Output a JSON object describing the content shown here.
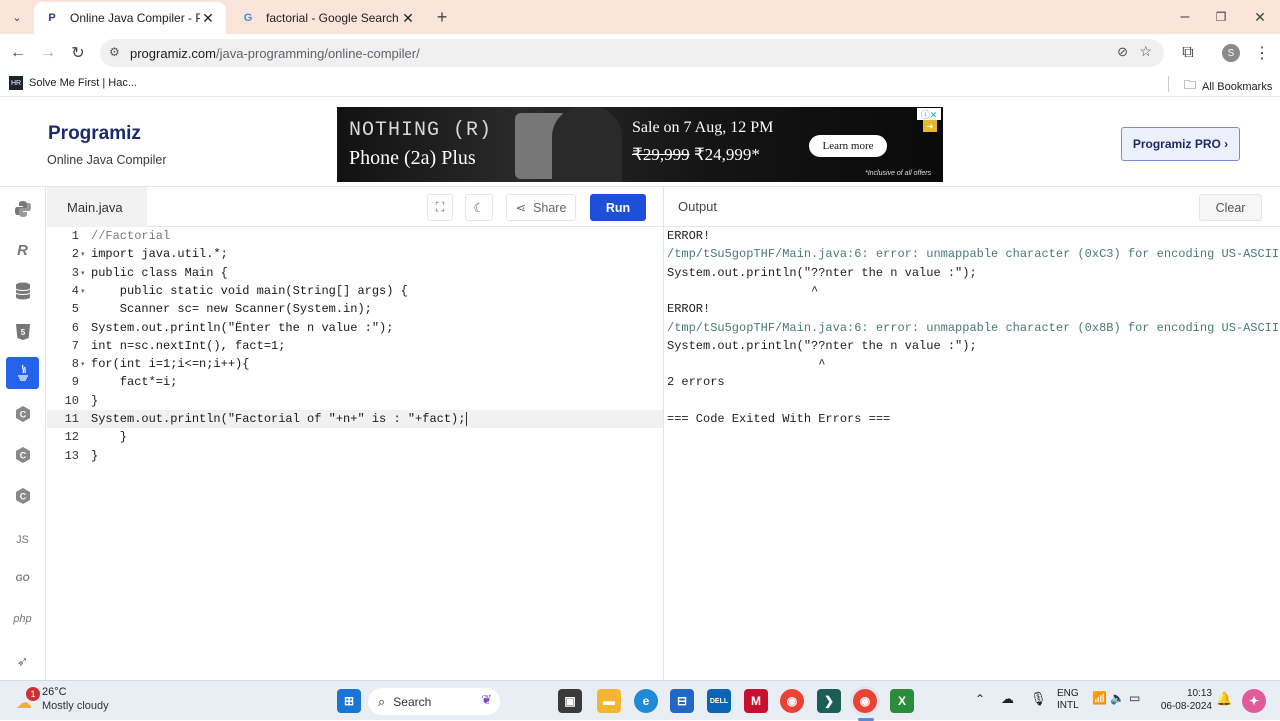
{
  "browser": {
    "tabs": [
      {
        "label": "Online Java Compiler - Program",
        "icon": "programiz-icon",
        "active": true
      },
      {
        "label": "factorial - Google Search",
        "icon": "google-icon",
        "active": false
      }
    ],
    "url_domain": "programiz.com",
    "url_path": "/java-programming/online-compiler/",
    "profile_initial": "S",
    "bookmarks": [
      {
        "label": "Solve Me First | Hac...",
        "icon": "hackerrank-icon"
      }
    ],
    "all_bookmarks": "All Bookmarks"
  },
  "site": {
    "logo_text": "Programiz",
    "logo_sub": "Online Java Compiler",
    "pro_button": "Programiz PRO ›",
    "ad": {
      "brand": "NOTHING (R)",
      "product": "Phone (2a) Plus",
      "sale": "Sale on 7 Aug, 12 PM",
      "old_price": "₹29,999",
      "new_price": "₹24,999*",
      "cta": "Learn more",
      "note": "*Inclusive of all offers"
    },
    "sidebar": [
      {
        "name": "python",
        "label": ""
      },
      {
        "name": "r",
        "label": ""
      },
      {
        "name": "sql",
        "label": ""
      },
      {
        "name": "html",
        "label": ""
      },
      {
        "name": "java",
        "label": ""
      },
      {
        "name": "c",
        "label": ""
      },
      {
        "name": "cpp",
        "label": ""
      },
      {
        "name": "csharp",
        "label": ""
      },
      {
        "name": "js",
        "label": "JS"
      },
      {
        "name": "go",
        "label": "GO"
      },
      {
        "name": "php",
        "label": "php"
      },
      {
        "name": "swift",
        "label": ""
      }
    ],
    "editor": {
      "file_name": "Main.java",
      "share_label": "Share",
      "run_label": "Run",
      "lines": [
        "//Factorial",
        "import java.util.*;",
        "public class Main {",
        "    public static void main(String[] args) {",
        "    Scanner sc= new Scanner(System.in);",
        "System.out.println(\"Ënter the n value :\");",
        "int n=sc.nextInt(), fact=1;",
        "for(int i=1;i<=n;i++){",
        "    fact*=i;",
        "}",
        "System.out.println(\"Factorial of \"+n+\" is : \"+fact);",
        "    }",
        "}"
      ]
    },
    "output": {
      "title": "Output",
      "clear_label": "Clear",
      "lines": [
        {
          "text": "ERROR!",
          "type": "plain"
        },
        {
          "text": "/tmp/tSu5gopTHF/Main.java:6: error: unmappable character (0xC3) for encoding US-ASCII",
          "type": "err"
        },
        {
          "text": "System.out.println(\"??nter the n value :\");",
          "type": "plain"
        },
        {
          "text": "                    ^",
          "type": "plain"
        },
        {
          "text": "ERROR!",
          "type": "plain"
        },
        {
          "text": "/tmp/tSu5gopTHF/Main.java:6: error: unmappable character (0x8B) for encoding US-ASCII",
          "type": "err"
        },
        {
          "text": "System.out.println(\"??nter the n value :\");",
          "type": "plain"
        },
        {
          "text": "                     ^",
          "type": "plain"
        },
        {
          "text": "2 errors",
          "type": "plain"
        },
        {
          "text": "",
          "type": "plain"
        },
        {
          "text": "=== Code Exited With Errors ===",
          "type": "plain"
        }
      ]
    }
  },
  "taskbar": {
    "weather_temp": "26°C",
    "weather_desc": "Mostly cloudy",
    "weather_badge": "1",
    "search_label": "Search",
    "lang_1": "ENG",
    "lang_2": "INTL",
    "time": "10:13",
    "date": "06-08-2024"
  },
  "colors": {
    "accent": "#1e4fd8",
    "tabbar": "#fbe4da",
    "error_text": "#4b7b73"
  }
}
